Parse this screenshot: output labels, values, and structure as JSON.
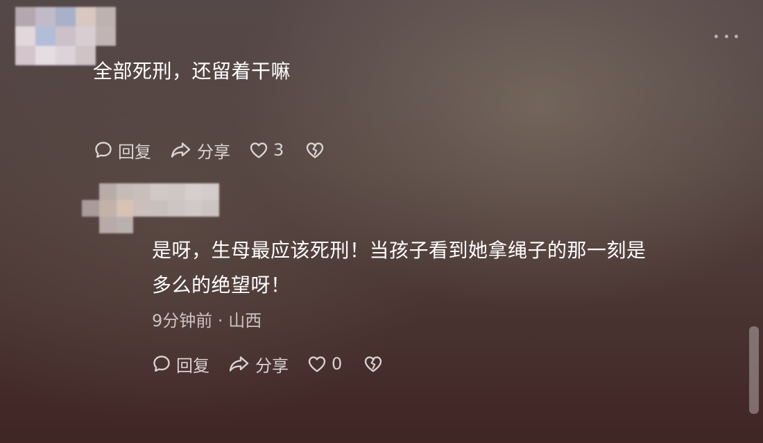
{
  "colors": {
    "background_top": "#554848",
    "background_bottom": "#402524",
    "text": "#ffffff",
    "muted_text": "#e6e1de"
  },
  "top_comment": {
    "text": "全部死刑，还留着干嘛",
    "actions": {
      "reply_label": "回复",
      "share_label": "分享",
      "like_count": "3",
      "reply_icon": "speech-bubble-icon",
      "share_icon": "share-arrow-icon",
      "like_icon": "heart-outline-icon",
      "dislike_icon": "broken-heart-icon"
    },
    "more_icon": "more-dots-icon"
  },
  "reply_comment": {
    "text_line1": "是呀，生母最应该死刑！当孩子看到她拿绳子的那一刻是",
    "text_line2": "多么的绝望呀！",
    "time": "9分钟前",
    "separator": "·",
    "location": "山西",
    "actions": {
      "reply_label": "回复",
      "share_label": "分享",
      "like_count": "0",
      "reply_icon": "speech-bubble-icon",
      "share_icon": "share-arrow-icon",
      "like_icon": "heart-outline-icon",
      "dislike_icon": "broken-heart-icon"
    }
  }
}
